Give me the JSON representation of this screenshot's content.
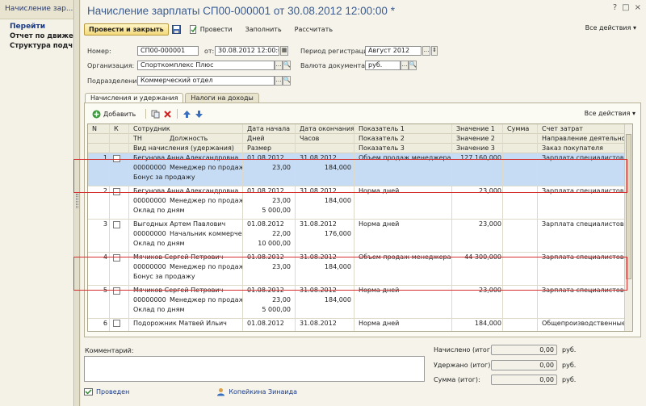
{
  "leftpanel": {
    "title": "Начисление зар...",
    "section": "Перейти",
    "items": [
      "Отчет по движе...",
      "Структура подч..."
    ]
  },
  "form": {
    "title": "Начисление зарплаты СП00-000001 от 30.08.2012 12:00:00 *",
    "window_buttons": [
      "?",
      "□",
      "×"
    ]
  },
  "toolbar": {
    "post_close": "Провести и закрыть",
    "post": "Провести",
    "fill": "Заполнить",
    "calculate": "Рассчитать",
    "all_actions": "Все действия"
  },
  "header": {
    "number_label": "Номер:",
    "number": "СП00-000001",
    "date_label": "от:",
    "date": "30.08.2012 12:00:00",
    "period_label": "Период регистрации:",
    "period": "Август 2012",
    "org_label": "Организация:",
    "org": "Спорткомплекс Плюс",
    "currency_label": "Валюта документа:",
    "currency": "руб.",
    "dept_label": "Подразделение:",
    "dept": "Коммерческий отдел"
  },
  "tabs": [
    "Начисления и удержания",
    "Налоги на доходы"
  ],
  "table_toolbar": {
    "add": "Добавить",
    "all_actions": "Все действия"
  },
  "columns": {
    "n": "N",
    "k": "К",
    "employee": "Сотрудник",
    "tn": "ТН",
    "position": "Должность",
    "accrual_type": "Вид начисления (удержания)",
    "date_start": "Дата начала",
    "days": "Дней",
    "amount_base": "Размер",
    "date_end": "Дата окончания",
    "hours": "Часов",
    "ind1": "Показатель 1",
    "ind2": "Показатель 2",
    "ind3": "Показатель 3",
    "val1": "Значение 1",
    "val2": "Значение 2",
    "val3": "Значение 3",
    "sum": "Сумма",
    "cost_account": "Счет затрат",
    "activity": "Направление деятельности",
    "order": "Заказ покупателя"
  },
  "rows": [
    {
      "n": "1",
      "employee": "Бегунова Анна Александровна",
      "tn": "000000008",
      "position": "Менеджер по продажам",
      "accrual": "Бонус за продажу",
      "date_start": "01.08.2012",
      "days": "23,00",
      "size": "",
      "date_end": "31.08.2012",
      "hours": "184,000",
      "ind1": "Объем продаж менеджера",
      "val1": "127 160,000",
      "cost": "Зарплата специалистов по п"
    },
    {
      "n": "2",
      "employee": "Бегунова Анна Александровна",
      "tn": "000000008",
      "position": "Менеджер по продажам",
      "accrual": "Оклад по дням",
      "date_start": "01.08.2012",
      "days": "23,00",
      "size": "5 000,00",
      "date_end": "31.08.2012",
      "hours": "184,000",
      "ind1": "Норма дней",
      "val1": "23,000",
      "cost": "Зарплата специалистов по п"
    },
    {
      "n": "3",
      "employee": "Выгодных Артем Павлович",
      "tn": "000000006",
      "position": "Начальник коммерчес...",
      "accrual": "Оклад по дням",
      "date_start": "01.08.2012",
      "days": "22,00",
      "size": "10 000,00",
      "date_end": "31.08.2012",
      "hours": "176,000",
      "ind1": "Норма дней",
      "val1": "23,000",
      "cost": "Зарплата специалистов по п"
    },
    {
      "n": "4",
      "employee": "Мячиков Сергей Петрович",
      "tn": "000000007",
      "position": "Менеджер по продажам",
      "accrual": "Бонус за продажу",
      "date_start": "01.08.2012",
      "days": "23,00",
      "size": "",
      "date_end": "31.08.2012",
      "hours": "184,000",
      "ind1": "Объем продаж менеджера",
      "val1": "44 300,000",
      "cost": "Зарплата специалистов по п"
    },
    {
      "n": "5",
      "employee": "Мячиков Сергей Петрович",
      "tn": "000000007",
      "position": "Менеджер по продажам",
      "accrual": "Оклад по дням",
      "date_start": "01.08.2012",
      "days": "23,00",
      "size": "5 000,00",
      "date_end": "31.08.2012",
      "hours": "184,000",
      "ind1": "Норма дней",
      "val1": "23,000",
      "cost": "Зарплата специалистов по п"
    }
  ],
  "partial_row": {
    "n": "6",
    "employee": "Подорожник Матвей Ильич",
    "date_start": "01.08.2012",
    "date_end": "31.08.2012",
    "ind1": "Норма дней",
    "val1": "184,000",
    "cost": "Общепроизводственные по п"
  },
  "bottom": {
    "comment_label": "Комментарий:",
    "accrued_label": "Начислено (итог):",
    "accrued": "0,00",
    "withheld_label": "Удержано (итог):",
    "withheld": "0,00",
    "total_label": "Сумма (итог):",
    "total": "0,00",
    "currency": "руб.",
    "status": "Проведен",
    "responsible": "Копейкина Зинаида"
  }
}
